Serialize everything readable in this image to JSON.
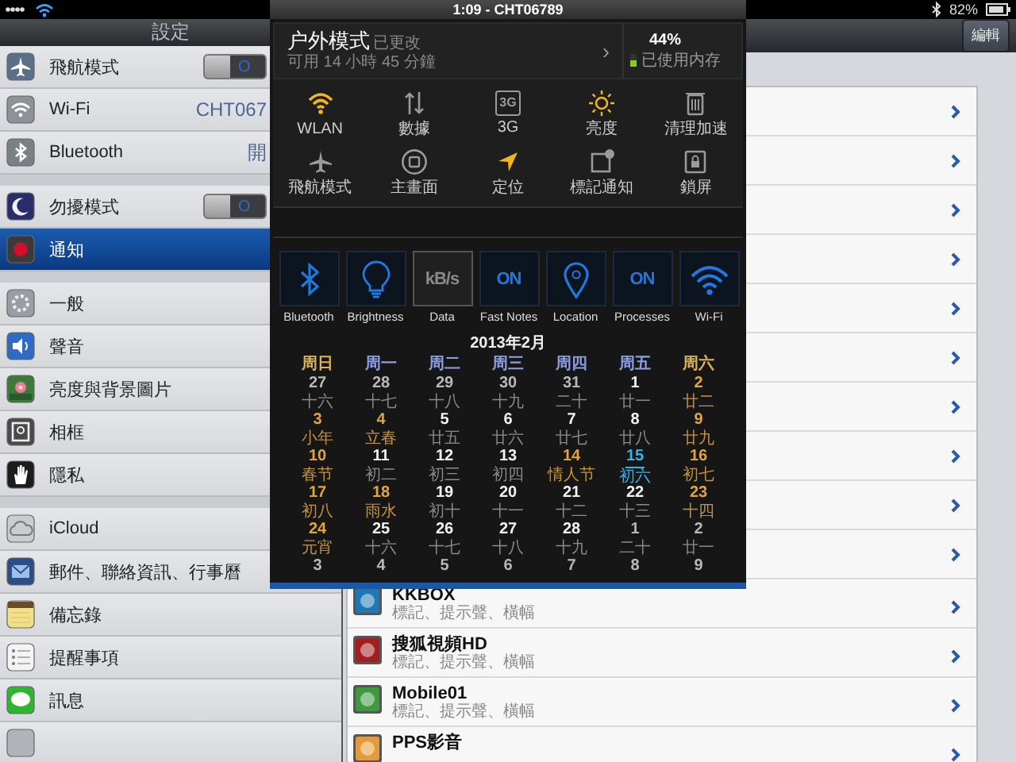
{
  "status_bar": {
    "battery": "82%"
  },
  "sidebar": {
    "title": "設定",
    "groups": [
      {
        "items": [
          {
            "label": "飛航模式",
            "kind": "toggle",
            "on": false,
            "toggle_text": "O",
            "selected": false
          },
          {
            "label": "Wi-Fi",
            "kind": "value",
            "value": "CHT067",
            "selected": false
          },
          {
            "label": "Bluetooth",
            "kind": "value",
            "value": "開",
            "selected": false
          }
        ]
      },
      {
        "items": [
          {
            "label": "勿擾模式",
            "kind": "toggle",
            "on": false,
            "toggle_text": "O",
            "selected": false
          },
          {
            "label": "通知",
            "kind": "plain",
            "selected": true
          }
        ]
      },
      {
        "items": [
          {
            "label": "一般",
            "kind": "plain",
            "selected": false
          },
          {
            "label": "聲音",
            "kind": "plain",
            "selected": false
          },
          {
            "label": "亮度與背景圖片",
            "kind": "plain",
            "selected": false
          },
          {
            "label": "相框",
            "kind": "plain",
            "selected": false
          },
          {
            "label": "隱私",
            "kind": "plain",
            "selected": false
          }
        ]
      },
      {
        "items": [
          {
            "label": "iCloud",
            "kind": "plain",
            "selected": false
          },
          {
            "label": "郵件、聯絡資訊、行事曆",
            "kind": "plain",
            "selected": false
          },
          {
            "label": "備忘錄",
            "kind": "plain",
            "selected": false
          },
          {
            "label": "提醒事項",
            "kind": "plain",
            "selected": false
          },
          {
            "label": "訊息",
            "kind": "plain",
            "selected": false
          },
          {
            "kind": "partial",
            "selected": false
          }
        ]
      }
    ]
  },
  "detail": {
    "edit_button": "編輯",
    "covered_rows": [
      {
        "chevron": true
      },
      {
        "chevron": true
      },
      {
        "chevron": true
      },
      {
        "chevron": true
      },
      {
        "chevron": true
      },
      {
        "chevron": true
      },
      {
        "chevron": true
      },
      {
        "chevron": true
      },
      {
        "chevron": true
      },
      {
        "chevron": true
      }
    ],
    "apps": [
      {
        "name": "KKBOX",
        "detail": "標記、提示聲、橫幅"
      },
      {
        "name": "搜狐視頻HD",
        "detail": "標記、提示聲、橫幅"
      },
      {
        "name": "Mobile01",
        "detail": "標記、提示聲、橫幅"
      },
      {
        "name": "PPS影音"
      }
    ]
  },
  "panel": {
    "clock": "1:09 - CHT06789",
    "profile": {
      "title": "户外模式",
      "badge": "已更改",
      "subtitle": "可用 14 小時 45 分鐘",
      "chevron": "›"
    },
    "memory": {
      "percent": "44%",
      "label": "已使用内存",
      "level": 0.44
    },
    "toggles": [
      {
        "label": "WLAN",
        "on": true
      },
      {
        "label": "數據",
        "on": false
      },
      {
        "label": "3G",
        "on": false,
        "glyph_text": "3G"
      },
      {
        "label": "亮度",
        "on": true
      },
      {
        "label": "清理加速",
        "on": false
      },
      {
        "label": "飛航模式",
        "on": false
      },
      {
        "label": "主畫面",
        "on": false
      },
      {
        "label": "定位",
        "on": true
      },
      {
        "label": "標記通知",
        "on": false
      },
      {
        "label": "鎖屏",
        "on": false
      }
    ],
    "widgets": [
      {
        "label": "Bluetooth",
        "on": true
      },
      {
        "label": "Brightness",
        "on": true
      },
      {
        "label": "Data",
        "on": false,
        "glyph_text": "kB/s"
      },
      {
        "label": "Fast Notes",
        "on": true,
        "glyph_text": "ON"
      },
      {
        "label": "Location",
        "on": true
      },
      {
        "label": "Processes",
        "on": true,
        "glyph_text": "ON"
      },
      {
        "label": "Wi-Fi",
        "on": true
      }
    ],
    "calendar": {
      "title": "2013年2月",
      "weekdays": [
        {
          "label": "周日",
          "kind": "weekend"
        },
        {
          "label": "周一",
          "kind": "weekday"
        },
        {
          "label": "周二",
          "kind": "weekday"
        },
        {
          "label": "周三",
          "kind": "weekday"
        },
        {
          "label": "周四",
          "kind": "weekday"
        },
        {
          "label": "周五",
          "kind": "weekday"
        },
        {
          "label": "周六",
          "kind": "weekend"
        }
      ],
      "weeks": [
        [
          {
            "day": "27",
            "lunar": "十六",
            "kind": "other"
          },
          {
            "day": "28",
            "lunar": "十七",
            "kind": "other"
          },
          {
            "day": "29",
            "lunar": "十八",
            "kind": "other"
          },
          {
            "day": "30",
            "lunar": "十九",
            "kind": "other"
          },
          {
            "day": "31",
            "lunar": "二十",
            "kind": "other"
          },
          {
            "day": "1",
            "lunar": "廿一",
            "kind": "normal"
          },
          {
            "day": "2",
            "lunar": "廿二",
            "kind": "holiday"
          }
        ],
        [
          {
            "day": "3",
            "lunar": "小年",
            "kind": "holiday"
          },
          {
            "day": "4",
            "lunar": "立春",
            "kind": "holiday"
          },
          {
            "day": "5",
            "lunar": "廿五",
            "kind": "normal"
          },
          {
            "day": "6",
            "lunar": "廿六",
            "kind": "normal"
          },
          {
            "day": "7",
            "lunar": "廿七",
            "kind": "normal"
          },
          {
            "day": "8",
            "lunar": "廿八",
            "kind": "normal"
          },
          {
            "day": "9",
            "lunar": "廿九",
            "kind": "holiday"
          }
        ],
        [
          {
            "day": "10",
            "lunar": "春节",
            "kind": "holiday"
          },
          {
            "day": "11",
            "lunar": "初二",
            "kind": "normal"
          },
          {
            "day": "12",
            "lunar": "初三",
            "kind": "normal"
          },
          {
            "day": "13",
            "lunar": "初四",
            "kind": "normal"
          },
          {
            "day": "14",
            "lunar": "情人节",
            "kind": "holiday"
          },
          {
            "day": "15",
            "lunar": "初六",
            "kind": "today"
          },
          {
            "day": "16",
            "lunar": "初七",
            "kind": "holiday"
          }
        ],
        [
          {
            "day": "17",
            "lunar": "初八",
            "kind": "holiday"
          },
          {
            "day": "18",
            "lunar": "雨水",
            "kind": "holiday"
          },
          {
            "day": "19",
            "lunar": "初十",
            "kind": "normal"
          },
          {
            "day": "20",
            "lunar": "十一",
            "kind": "normal"
          },
          {
            "day": "21",
            "lunar": "十二",
            "kind": "normal"
          },
          {
            "day": "22",
            "lunar": "十三",
            "kind": "normal"
          },
          {
            "day": "23",
            "lunar": "十四",
            "kind": "holiday"
          }
        ],
        [
          {
            "day": "24",
            "lunar": "元宵",
            "kind": "holiday"
          },
          {
            "day": "25",
            "lunar": "十六",
            "kind": "normal"
          },
          {
            "day": "26",
            "lunar": "十七",
            "kind": "normal"
          },
          {
            "day": "27",
            "lunar": "十八",
            "kind": "normal"
          },
          {
            "day": "28",
            "lunar": "十九",
            "kind": "normal"
          },
          {
            "day": "1",
            "lunar": "二十",
            "kind": "other"
          },
          {
            "day": "2",
            "lunar": "廿一",
            "kind": "other"
          }
        ],
        [
          {
            "day": "3",
            "kind": "other"
          },
          {
            "day": "4",
            "kind": "other"
          },
          {
            "day": "5",
            "kind": "other"
          },
          {
            "day": "6",
            "kind": "other"
          },
          {
            "day": "7",
            "kind": "other"
          },
          {
            "day": "8",
            "kind": "other"
          },
          {
            "day": "9",
            "kind": "other"
          }
        ]
      ]
    }
  }
}
